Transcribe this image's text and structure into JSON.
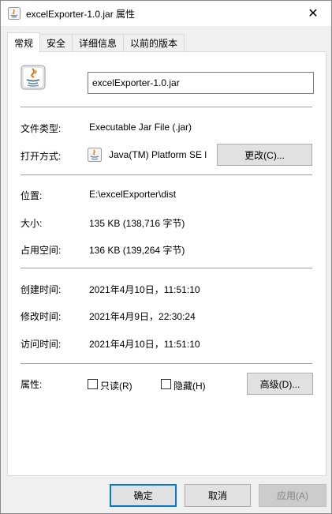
{
  "window": {
    "title": "excelExporter-1.0.jar 属性",
    "close_glyph": "✕"
  },
  "tabs": [
    {
      "label": "常规",
      "active": true
    },
    {
      "label": "安全",
      "active": false
    },
    {
      "label": "详细信息",
      "active": false
    },
    {
      "label": "以前的版本",
      "active": false
    }
  ],
  "general": {
    "file_name": "excelExporter-1.0.jar",
    "file_type_label": "文件类型:",
    "file_type_value": "Executable Jar File (.jar)",
    "opens_with_label": "打开方式:",
    "opens_with_value": "Java(TM) Platform SE l",
    "change_button": "更改(C)...",
    "location_label": "位置:",
    "location_value": "E:\\excelExporter\\dist",
    "size_label": "大小:",
    "size_value": "135 KB (138,716 字节)",
    "size_on_disk_label": "占用空间:",
    "size_on_disk_value": "136 KB (139,264 字节)",
    "created_label": "创建时间:",
    "created_value": "2021年4月10日，11:51:10",
    "modified_label": "修改时间:",
    "modified_value": "2021年4月9日，22:30:24",
    "accessed_label": "访问时间:",
    "accessed_value": "2021年4月10日，11:51:10",
    "attributes_label": "属性:",
    "readonly_label": "只读(R)",
    "hidden_label": "隐藏(H)",
    "advanced_button": "高级(D)..."
  },
  "footer": {
    "ok_button": "确定",
    "cancel_button": "取消",
    "apply_button": "应用(A)"
  },
  "icons": {
    "title": "java-jar-icon",
    "file": "java-jar-icon",
    "opens_with": "java-icon"
  },
  "colors": {
    "accent": "#0078d7",
    "java_red": "#e76f00",
    "java_blue": "#5382a1"
  }
}
